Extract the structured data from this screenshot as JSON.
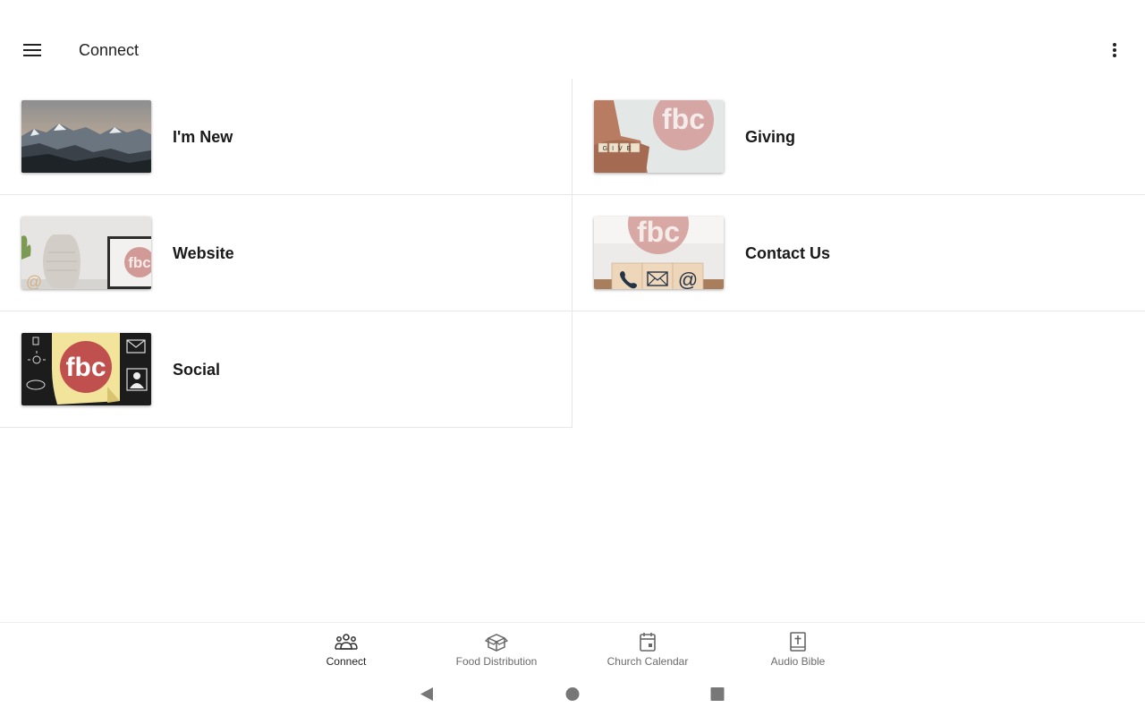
{
  "app_bar": {
    "title": "Connect",
    "menu_icon": "hamburger-menu-icon",
    "more_icon": "more-vertical-icon"
  },
  "tiles": [
    {
      "label": "I'm New",
      "thumbnail": "mountain-landscape"
    },
    {
      "label": "Giving",
      "thumbnail": "give-hands-fbc"
    },
    {
      "label": "Website",
      "thumbnail": "vase-laptop-fbc"
    },
    {
      "label": "Contact Us",
      "thumbnail": "contact-blocks-fbc"
    },
    {
      "label": "Social",
      "thumbnail": "sticky-note-fbc"
    }
  ],
  "thumbnail_text": {
    "logo": "fbc",
    "give_letters": "GIVE",
    "at_symbol": "@"
  },
  "bottom_nav": [
    {
      "label": "Connect",
      "icon": "people-group-icon",
      "active": true
    },
    {
      "label": "Food Distribution",
      "icon": "box-icon",
      "active": false
    },
    {
      "label": "Church Calendar",
      "icon": "calendar-icon",
      "active": false
    },
    {
      "label": "Audio Bible",
      "icon": "bible-icon",
      "active": false
    }
  ],
  "system_nav": {
    "back_icon": "back-triangle-icon",
    "home_icon": "home-circle-icon",
    "recents_icon": "recents-square-icon"
  },
  "colors": {
    "brand_logo": "#c0504d",
    "divider": "#e6e6e6",
    "text": "#1a1a1a"
  }
}
